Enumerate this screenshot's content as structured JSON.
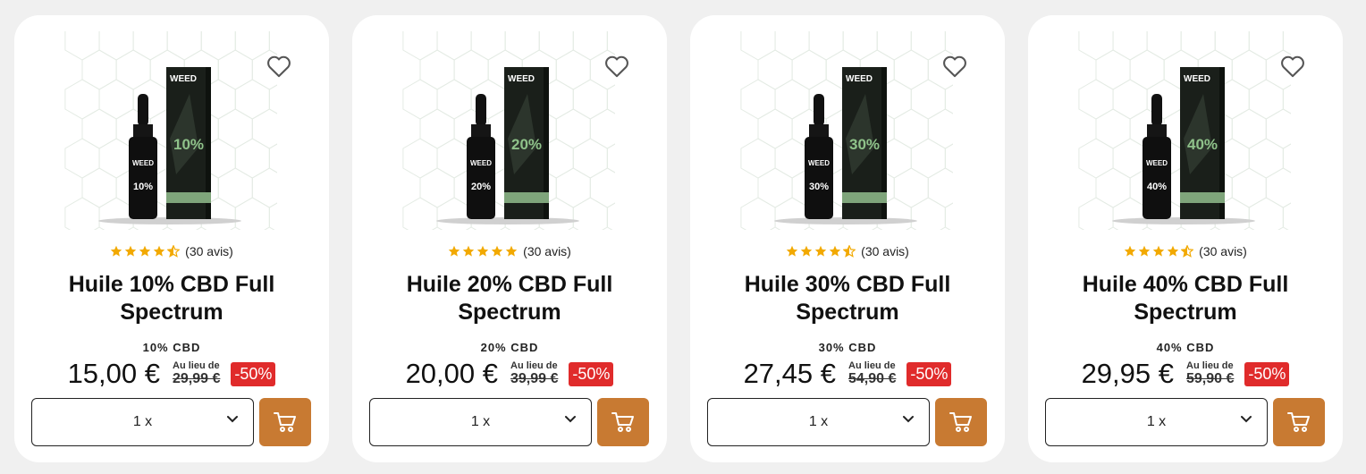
{
  "colors": {
    "accent": "#c87a32",
    "discount": "#e02b2b",
    "star": "#f2a900",
    "background": "#f0f0f0"
  },
  "products": [
    {
      "title": "Huile 10% CBD Full Spectrum",
      "rating": 4.5,
      "reviews": "(30 avis)",
      "variant": "10% CBD",
      "price": "15,00 €",
      "old_label": "Au lieu de",
      "old_price": "29,99 €",
      "discount": "-50%",
      "quantity": "1 x",
      "image": {
        "box_label": "10%",
        "bottle_label": "10%",
        "brand": "WEED"
      }
    },
    {
      "title": "Huile 20% CBD Full Spectrum",
      "rating": 5,
      "reviews": "(30 avis)",
      "variant": "20% CBD",
      "price": "20,00 €",
      "old_label": "Au lieu de",
      "old_price": "39,99 €",
      "discount": "-50%",
      "quantity": "1 x",
      "image": {
        "box_label": "20%",
        "bottle_label": "20%",
        "brand": "WEED"
      }
    },
    {
      "title": "Huile 30% CBD Full Spectrum",
      "rating": 4.5,
      "reviews": "(30 avis)",
      "variant": "30% CBD",
      "price": "27,45 €",
      "old_label": "Au lieu de",
      "old_price": "54,90 €",
      "discount": "-50%",
      "quantity": "1 x",
      "image": {
        "box_label": "30%",
        "bottle_label": "30%",
        "brand": "WEED"
      }
    },
    {
      "title": "Huile 40% CBD Full Spectrum",
      "rating": 4.5,
      "reviews": "(30 avis)",
      "variant": "40% CBD",
      "price": "29,95 €",
      "old_label": "Au lieu de",
      "old_price": "59,90 €",
      "discount": "-50%",
      "quantity": "1 x",
      "image": {
        "box_label": "40%",
        "bottle_label": "40%",
        "brand": "WEED"
      }
    }
  ],
  "icons": {
    "wishlist": "heart-outline-icon",
    "select": "chevron-down-icon",
    "cart": "shopping-cart-icon",
    "star": "star-icon"
  }
}
